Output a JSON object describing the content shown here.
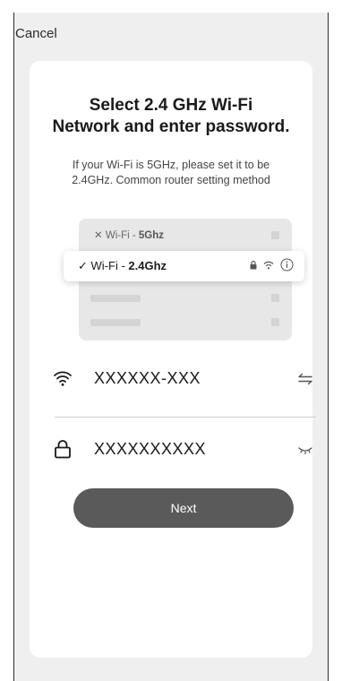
{
  "header": {
    "cancel_label": "Cancel"
  },
  "card": {
    "title_line1": "Select 2.4 GHz Wi-Fi",
    "title_line2": "Network and enter password.",
    "subtitle_line1": "If your Wi-Fi is 5GHz, please set it to be",
    "subtitle_line2": "2.4GHz. Common router setting method"
  },
  "illustration": {
    "row1_prefix": "Wi-Fi - ",
    "row1_band": "5Ghz",
    "row2_prefix": "Wi-Fi - ",
    "row2_band": "2.4Ghz",
    "icons": [
      "close-icon",
      "check-icon",
      "lock-icon",
      "wifi-icon",
      "info-icon"
    ]
  },
  "form": {
    "network_value": "XXXXXX-XXX",
    "password_value": "XXXXXXXXXX",
    "icons": [
      "wifi-icon",
      "switch-network-icon",
      "lock-icon",
      "eye-closed-icon"
    ]
  },
  "actions": {
    "next_label": "Next"
  },
  "colors": {
    "button": "#5a5a5a",
    "background": "#efefef",
    "card": "#ffffff"
  }
}
